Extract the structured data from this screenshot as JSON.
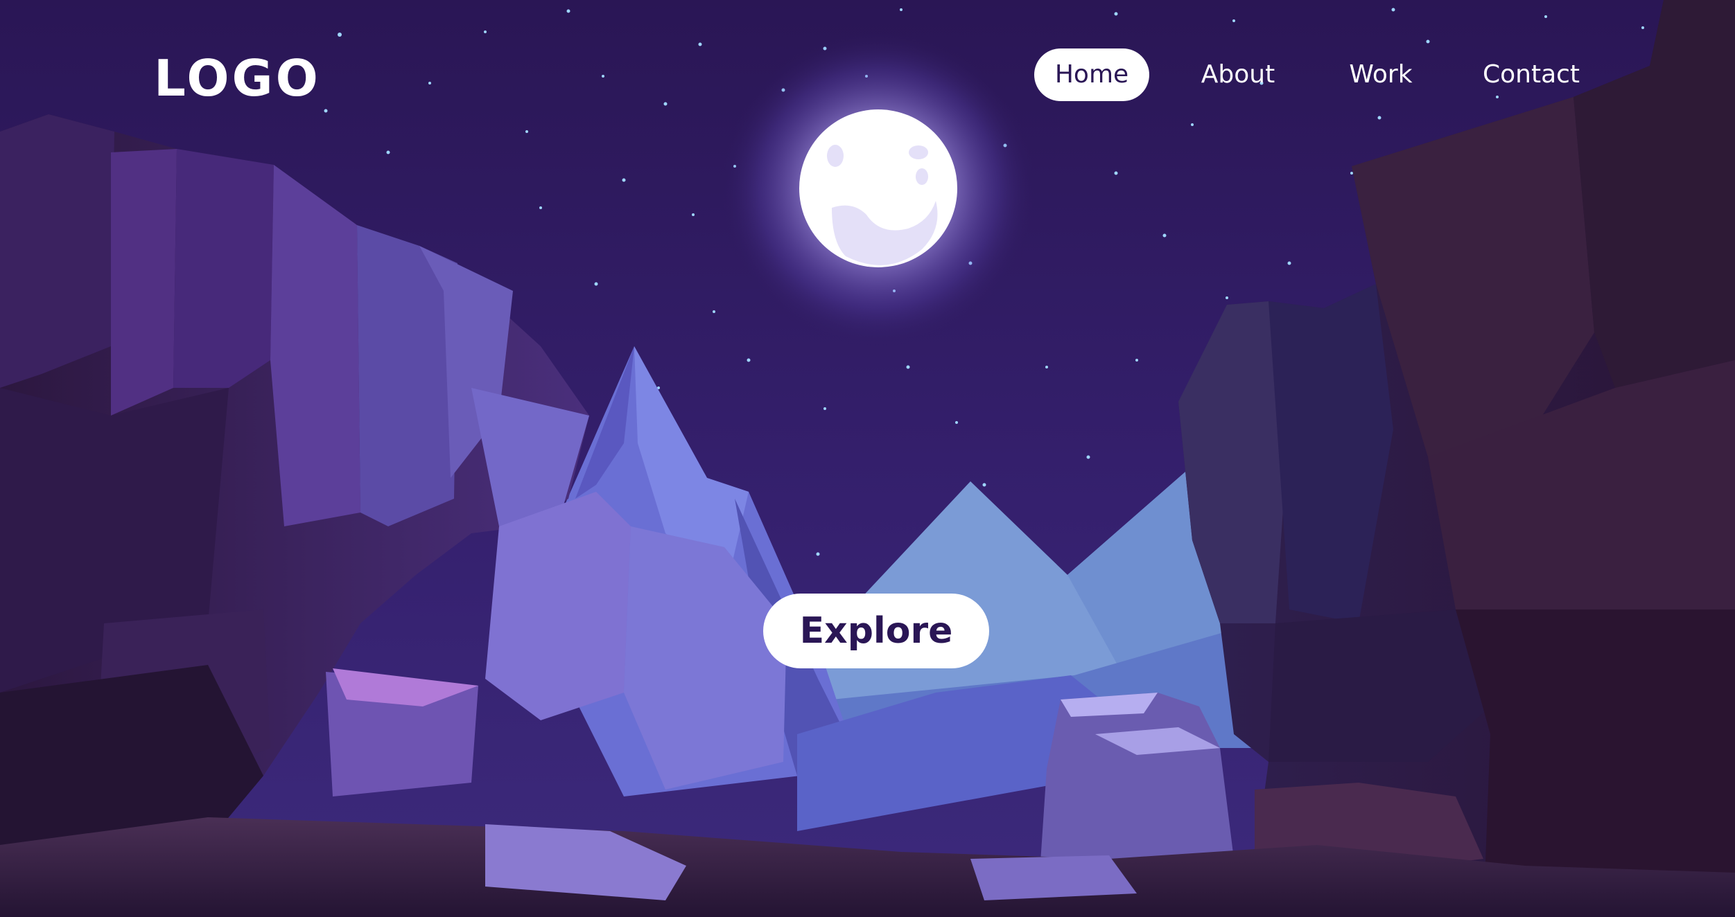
{
  "header": {
    "logo_text": "LOGO",
    "nav": [
      {
        "label": "Home",
        "active": true
      },
      {
        "label": "About",
        "active": false
      },
      {
        "label": "Work",
        "active": false
      },
      {
        "label": "Contact",
        "active": false
      }
    ]
  },
  "hero": {
    "cta_label": "Explore"
  },
  "colors": {
    "sky_top": "#2a1655",
    "sky_bottom": "#3d2275",
    "moon": "#ffffff",
    "accent_text": "#2a1655",
    "button_bg": "#ffffff"
  }
}
